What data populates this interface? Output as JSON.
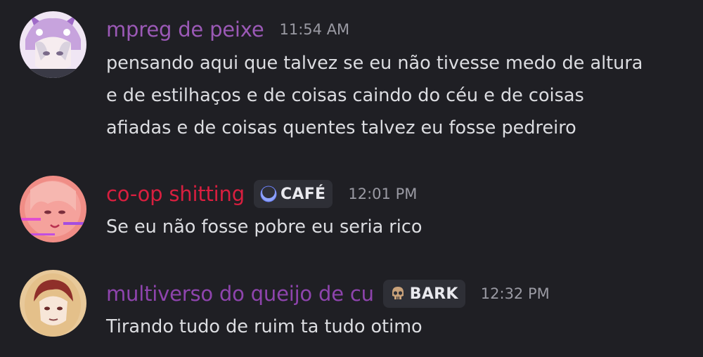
{
  "messages": [
    {
      "username": "mpreg de peixe",
      "username_color": "#9b59b6",
      "timestamp": "11:54 AM",
      "lines": [
        "pensando aqui que talvez se eu não tivesse medo de altura",
        "e de estilhaços e de coisas caindo do céu e de coisas",
        "afiadas e de coisas quentes talvez eu fosse pedreiro"
      ]
    },
    {
      "username": "co-op shitting",
      "username_color": "#d81f3f",
      "tag": {
        "label": "CAFÉ",
        "icon": "moon-icon"
      },
      "timestamp": "12:01 PM",
      "lines": [
        "Se eu não fosse pobre eu seria rico"
      ]
    },
    {
      "username": "multiverso do queijo de cu",
      "username_color": "#8e44ad",
      "tag": {
        "label": "BARK",
        "icon": "skull-icon"
      },
      "timestamp": "12:32 PM",
      "lines": [
        "Tirando tudo de ruim ta tudo otimo"
      ]
    }
  ]
}
